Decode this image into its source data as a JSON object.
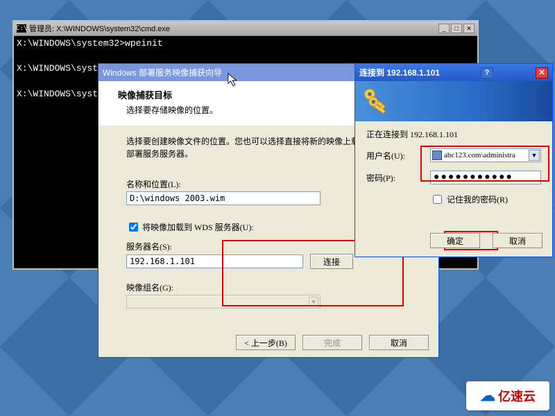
{
  "cmd": {
    "title": "管理员: X:\\WINDOWS\\system32\\cmd.exe",
    "icon": "C:\\",
    "line1": "X:\\WINDOWS\\system32>wpeinit",
    "line2": "X:\\WINDOWS\\syste",
    "line3": "X:\\WINDOWS\\syste"
  },
  "wizard": {
    "title": "Windows 部署服务映像捕获向导",
    "header": "映像捕获目标",
    "subheader": "选择要存储映像的位置。",
    "desc": "选择要创建映像文件的位置。您也可以选择直接将新的映像上载到 Windows\n部署服务服务器。",
    "name_loc_label": "名称和位置(L):",
    "name_loc_value": "D:\\windows 2003.wim",
    "upload_checkbox": "将映像加载到 WDS 服务器(U):",
    "server_label": "服务器名(S):",
    "server_value": "192.168.1.101",
    "connect_btn": "连接",
    "group_label": "映像组名(G):",
    "group_value": "",
    "back": "< 上一步(B)",
    "finish": "完成",
    "cancel": "取消"
  },
  "connect": {
    "title": "连接到 192.168.1.101",
    "connecting": "正在连接到 192.168.1.101",
    "user_label": "用户名(U):",
    "user_value": "abc123.com\\administra",
    "pwd_label": "密码(P):",
    "pwd_mask": "●●●●●●●●●●●",
    "remember": "记住我的密码(R)",
    "ok": "确定",
    "cancel": "取消"
  },
  "watermark": "亿速云"
}
